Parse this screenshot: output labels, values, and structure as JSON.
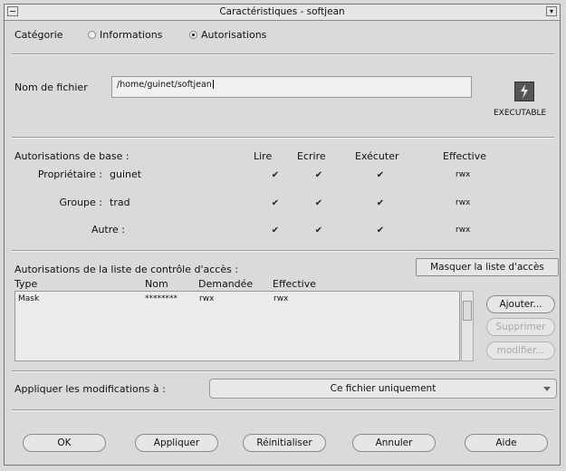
{
  "window": {
    "title": "Caractéristiques - softjean"
  },
  "category": {
    "label": "Catégorie",
    "options": [
      {
        "label": "Informations",
        "selected": false
      },
      {
        "label": "Autorisations",
        "selected": true
      }
    ]
  },
  "file": {
    "label": "Nom de fichier",
    "value": "/home/guinet/softjean",
    "type_label": "EXECUTABLE",
    "icon": "executable-icon"
  },
  "basic_perms": {
    "title": "Autorisations de base :",
    "columns": [
      "Lire",
      "Ecrire",
      "Exécuter",
      "Effective"
    ],
    "rows": [
      {
        "label": "Propriétaire :",
        "name": "guinet",
        "read": true,
        "write": true,
        "exec": true,
        "effective": "rwx"
      },
      {
        "label": "Groupe :",
        "name": "trad",
        "read": true,
        "write": true,
        "exec": true,
        "effective": "rwx"
      },
      {
        "label": "Autre :",
        "name": "",
        "read": true,
        "write": true,
        "exec": true,
        "effective": "rwx"
      }
    ]
  },
  "acl": {
    "title": "Autorisations de la liste de contrôle d'accès :",
    "toggle_button": "Masquer la liste d'accès",
    "headers": [
      "Type",
      "Nom",
      "Demandée",
      "Effective"
    ],
    "rows": [
      {
        "type": "Mask",
        "name": "********",
        "requested": "rwx",
        "effective": "rwx"
      }
    ],
    "buttons": {
      "add": "Ajouter...",
      "delete": "Supprimer",
      "modify": "modifier..."
    }
  },
  "apply_to": {
    "label": "Appliquer les modifications à :",
    "value": "Ce fichier uniquement"
  },
  "footer": {
    "ok": "OK",
    "apply": "Appliquer",
    "reset": "Réinitialiser",
    "cancel": "Annuler",
    "help": "Aide"
  },
  "colors": {
    "background": "#d9d9d9",
    "field": "#f0f0f0",
    "border": "#999999"
  }
}
